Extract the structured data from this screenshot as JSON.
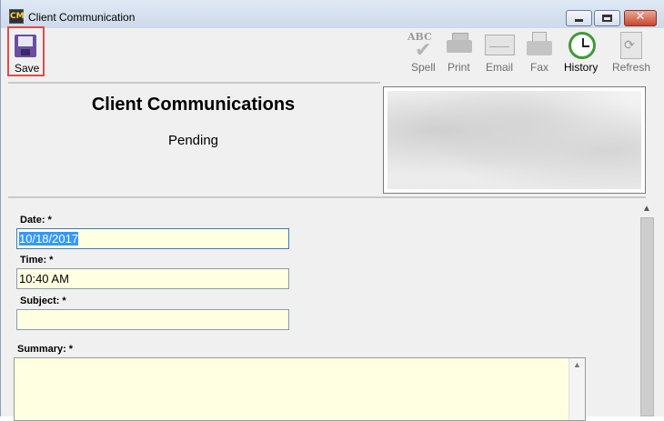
{
  "window": {
    "title": "Client Communication",
    "app_icon_text": "CM"
  },
  "toolbar": {
    "save_label": "Save",
    "spell_label": "Spell",
    "print_label": "Print",
    "email_label": "Email",
    "fax_label": "Fax",
    "history_label": "History",
    "refresh_label": "Refresh",
    "spell_icon_text": "ABC"
  },
  "header": {
    "title": "Client Communications",
    "status": "Pending"
  },
  "form": {
    "date": {
      "label": "Date:",
      "required": "*",
      "value": "10/18/2017"
    },
    "time": {
      "label": "Time:",
      "required": "*",
      "value": "10:40 AM"
    },
    "subject": {
      "label": "Subject:",
      "required": "*",
      "value": ""
    },
    "summary": {
      "label": "Summary:",
      "required": "*",
      "value": ""
    }
  },
  "colors": {
    "highlight": "#e24b4b",
    "input_bg": "#ffffe1",
    "selection": "#3399ff"
  }
}
